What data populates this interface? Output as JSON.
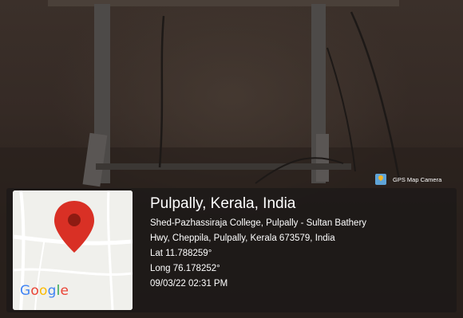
{
  "badge": {
    "label": "GPS Map Camera",
    "icon": "gps-map-camera-icon"
  },
  "location": {
    "title": "Pulpally, Kerala, India",
    "address_line1": "Shed-Pazhassiraja College, Pulpally - Sultan Bathery",
    "address_line2": "Hwy, Cheppila, Pulpally, Kerala 673579, India",
    "latitude": "Lat 11.788259°",
    "longitude": "Long 76.178252°",
    "datetime": "09/03/22 02:31 PM"
  },
  "map": {
    "logo_text": [
      "G",
      "o",
      "o",
      "g",
      "l",
      "e"
    ],
    "pin_color": "#d93025"
  }
}
